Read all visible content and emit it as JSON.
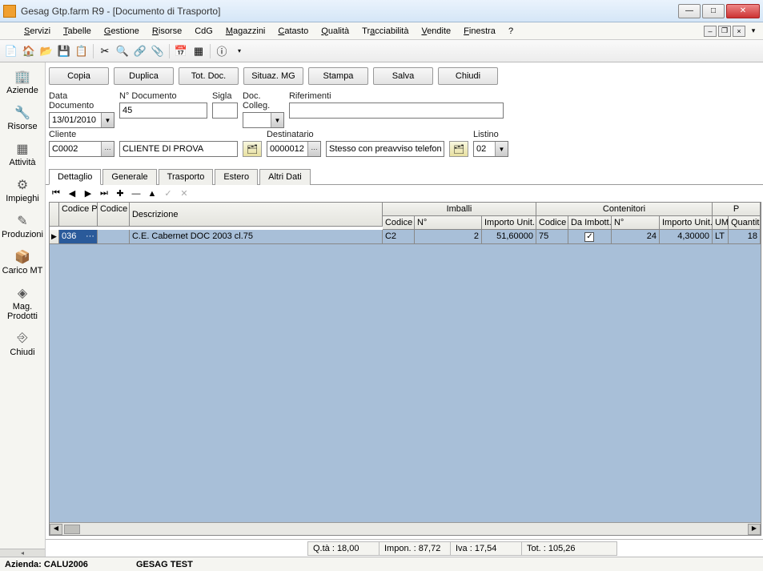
{
  "title": "Gesag Gtp.farm R9 - [Documento di Trasporto]",
  "menus": [
    "Servizi",
    "Tabelle",
    "Gestione",
    "Risorse",
    "CdG",
    "Magazzini",
    "Catasto",
    "Qualità",
    "Tracciabilità",
    "Vendite",
    "Finestra",
    "?"
  ],
  "sidebar": [
    {
      "icon": "🏢",
      "label": "Aziende",
      "name": "sidebar-aziende"
    },
    {
      "icon": "🔧",
      "label": "Risorse",
      "name": "sidebar-risorse"
    },
    {
      "icon": "▦",
      "label": "Attività",
      "name": "sidebar-attivita"
    },
    {
      "icon": "⚙",
      "label": "Impieghi",
      "name": "sidebar-impieghi"
    },
    {
      "icon": "✎",
      "label": "Produzioni",
      "name": "sidebar-produzioni"
    },
    {
      "icon": "📦",
      "label": "Carico MT",
      "name": "sidebar-carico-mt"
    },
    {
      "icon": "◈",
      "label": "Mag. Prodotti",
      "name": "sidebar-mag-prodotti"
    },
    {
      "icon": "⎆",
      "label": "Chiudi",
      "name": "sidebar-chiudi"
    }
  ],
  "actions": {
    "copia": "Copia",
    "duplica": "Duplica",
    "totdoc": "Tot. Doc.",
    "situazmg": "Situaz. MG",
    "stampa": "Stampa",
    "salva": "Salva",
    "chiudi": "Chiudi"
  },
  "form": {
    "datadoc_label": "Data Documento",
    "datadoc": "13/01/2010",
    "ndoc_label": "N° Documento",
    "ndoc": "45",
    "sigla_label": "Sigla",
    "sigla": "",
    "doccolleg_label": "Doc. Colleg.",
    "doccolleg": "",
    "riferimenti_label": "Riferimenti",
    "riferimenti": "",
    "cliente_label": "Cliente",
    "cliente_code": "C0002",
    "cliente_name": "CLIENTE DI PROVA",
    "dest_label": "Destinatario",
    "dest_code": "0000012",
    "dest_name": "Stesso con preavviso telefonic",
    "listino_label": "Listino",
    "listino": "02"
  },
  "tabs": [
    "Dettaglio",
    "Generale",
    "Trasporto",
    "Estero",
    "Altri Dati"
  ],
  "grid": {
    "group_imballi": "Imballi",
    "group_contenitori": "Contenitori",
    "group_p": "P",
    "h_codprod": "Codice Prodotto",
    "h_codspesa": "Codice Spesa",
    "h_descr": "Descrizione",
    "h_codice": "Codice",
    "h_n": "N°",
    "h_impunit": "Importo Unit.",
    "h_daimbott": "Da Imbott.",
    "h_um": "UM",
    "h_qta": "Quantità",
    "rows": [
      {
        "codprod": "036",
        "codspesa": "",
        "descr": "C.E. Cabernet DOC 2003 cl.75",
        "imb_cod": "C2",
        "imb_n": "2",
        "imb_imp": "51,60000",
        "con_cod": "75",
        "con_imb": true,
        "con_n": "24",
        "con_imp": "4,30000",
        "um": "LT",
        "qta": "18"
      }
    ]
  },
  "summary": {
    "qta": "Q.tà : 18,00",
    "impon": "Impon. : 87,72",
    "iva": "Iva : 17,54",
    "tot": "Tot. : 105,26"
  },
  "status": {
    "azienda_label": "Azienda:",
    "azienda": "CALU2006",
    "user": "GESAG TEST"
  }
}
